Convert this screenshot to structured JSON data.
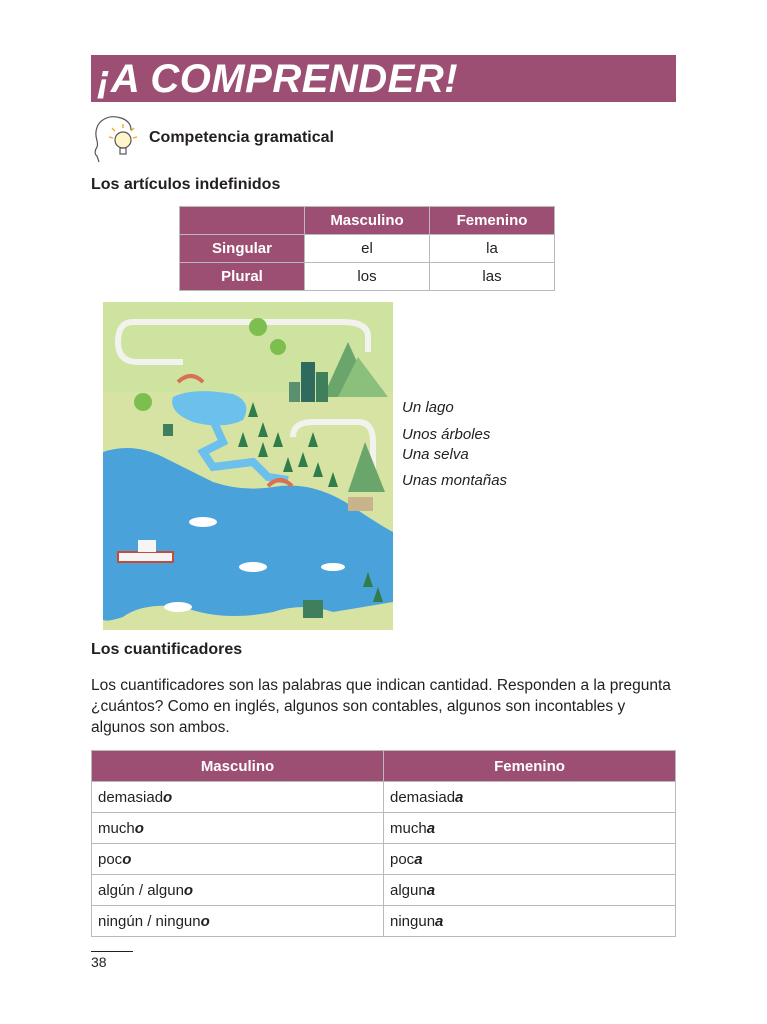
{
  "banner": {
    "title": "¡A COMPRENDER!",
    "color": "#9c4f73"
  },
  "section": {
    "icon": "head-lightbulb-icon",
    "label": "Competencia gramatical"
  },
  "articles": {
    "heading": "Los artículos indefinidos",
    "header": [
      "",
      "Masculino",
      "Femenino"
    ],
    "rows": [
      {
        "label": "Singular",
        "masc": "el",
        "fem": "la"
      },
      {
        "label": "Plural",
        "masc": "los",
        "fem": "las"
      }
    ]
  },
  "map_labels": [
    "Un lago",
    "Unos árboles",
    "Una selva",
    "Unas montañas"
  ],
  "quantifiers": {
    "heading": "Los cuantificadores",
    "paragraph": "Los cuantificadores son las palabras que indican cantidad. Responden a la pregunta ¿cuántos? Como en inglés, algunos son contables, algunos son incontables y algunos son ambos.",
    "header": [
      "Masculino",
      "Femenino"
    ],
    "rows": [
      {
        "masc_stem": "demasiad",
        "masc_end": "o",
        "fem_stem": "demasiad",
        "fem_end": "a"
      },
      {
        "masc_stem": "much",
        "masc_end": "o",
        "fem_stem": "much",
        "fem_end": "a"
      },
      {
        "masc_stem": "poc",
        "masc_end": "o",
        "fem_stem": "poc",
        "fem_end": "a"
      },
      {
        "masc_stem": "algún / algun",
        "masc_end": "o",
        "fem_stem": "algun",
        "fem_end": "a"
      },
      {
        "masc_stem": "ningún / ningun",
        "masc_end": "o",
        "fem_stem": "ningun",
        "fem_end": "a"
      }
    ]
  },
  "page_number": "38"
}
